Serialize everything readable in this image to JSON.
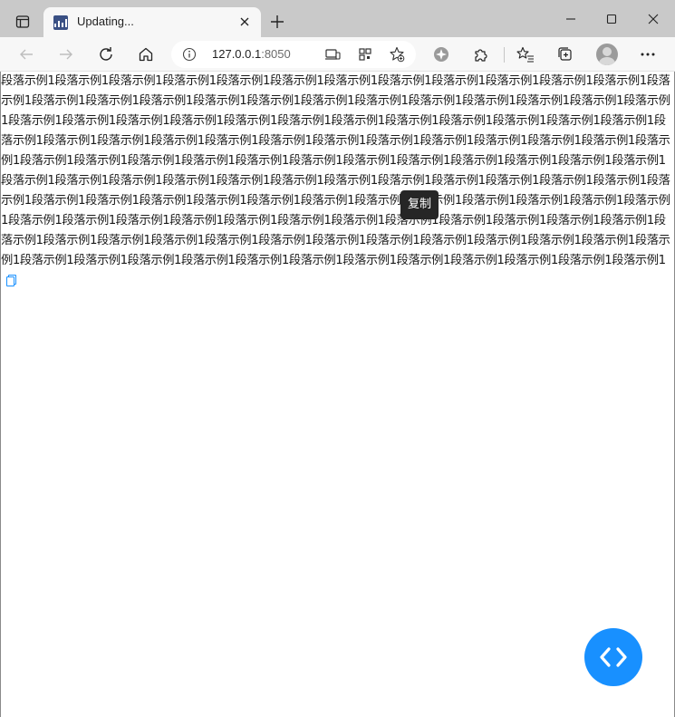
{
  "browser": {
    "tab": {
      "title": "Updating..."
    },
    "address": {
      "host": "127.0.0.1",
      "port": ":8050"
    }
  },
  "page": {
    "paragraph": "段落示例1段落示例1段落示例1段落示例1段落示例1段落示例1段落示例1段落示例1段落示例1段落示例1段落示例1段落示例1段落示例1段落示例1段落示例1段落示例1段落示例1段落示例1段落示例1段落示例1段落示例1段落示例1段落示例1段落示例1段落示例1段落示例1段落示例1段落示例1段落示例1段落示例1段落示例1段落示例1段落示例1段落示例1段落示例1段落示例1段落示例1段落示例1段落示例1段落示例1段落示例1段落示例1段落示例1段落示例1段落示例1段落示例1段落示例1段落示例1段落示例1段落示例1段落示例1段落示例1段落示例1段落示例1段落示例1段落示例1段落示例1段落示例1段落示例1段落示例1段落示例1段落示例1段落示例1段落示例1段落示例1段落示例1段落示例1段落示例1段落示例1段落示例1段落示例1段落示例1段落示例1段落示例1段落示例1段落示例1段落示例1段落示例1段落示例1段落示例1段落示例1段落示例1段落示例1段落示例1段落示例1段落示例1段落示例1段落示例1段落示例1段落示例1段落示例1段落示例1段落示例1段落示例1段落示例1段落示例1段落示例1段落示例1段落示例1段落示例1段落示例1段落示例1段落示例1段落示例1段落示例1段落示例1段落示例1段落示例1段落示例1段落示例1段落示例1段落示例1段落示例1段落示例1段落示例1段落示例1段落示例1段落示例1段落示例1段落示例1段落示例1段落示例1段落示例1段落示例1",
    "tooltip": "复制"
  },
  "colors": {
    "accent": "#1890ff",
    "tooltip_bg": "#262626",
    "titlebar": "#c9c9c9",
    "toolbar": "#f7f7f7"
  }
}
